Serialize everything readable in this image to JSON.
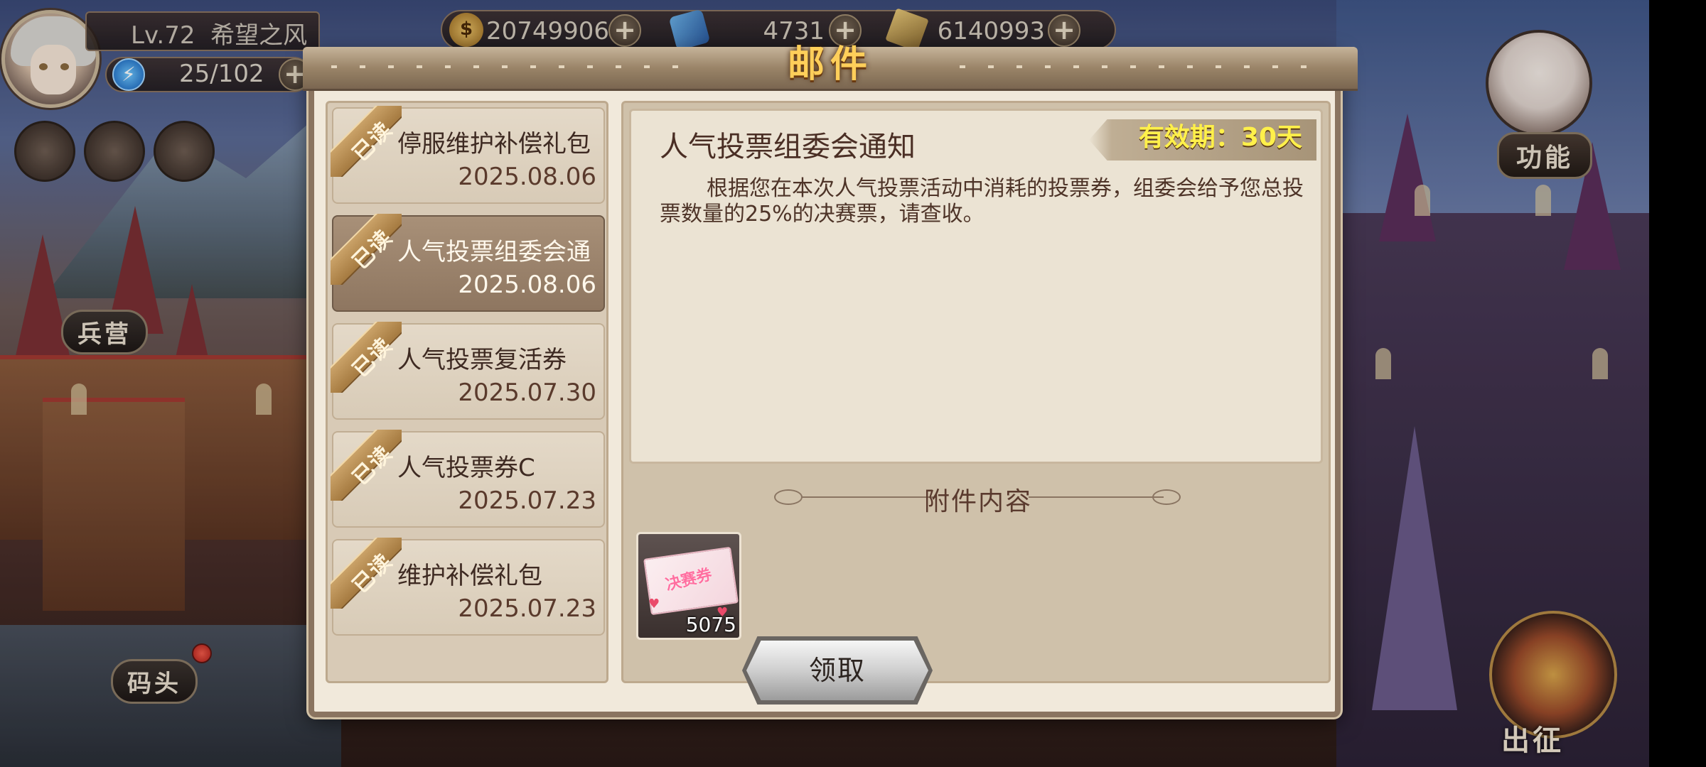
{
  "hud": {
    "level": "Lv.72",
    "player_name": "希望之风",
    "energy": "25/102",
    "gold": "20749906",
    "ticket": "4731",
    "gem": "6140993",
    "gold_icon_glyph": "$",
    "plus": "+",
    "energy_glyph": "⚡"
  },
  "side": {
    "barracks_label": "兵营",
    "dock_label": "码头",
    "function_label": "功能",
    "expedition_label": "出征"
  },
  "mail": {
    "title": "邮件",
    "read_tag": "已读",
    "items": [
      {
        "title": "停服维护补偿礼包",
        "date": "2025.08.06"
      },
      {
        "title": "人气投票组委会通",
        "date": "2025.08.06"
      },
      {
        "title": "人气投票复活券",
        "date": "2025.07.30"
      },
      {
        "title": "人气投票券C",
        "date": "2025.07.23"
      },
      {
        "title": "维护补偿礼包",
        "date": "2025.07.23"
      }
    ],
    "selected": {
      "title": "人气投票组委会通知",
      "validity": "有效期：30天",
      "body": "根据您在本次人气投票活动中消耗的投票券，组委会给予您总投票数量的25%的决赛票，请查收。"
    },
    "attachment_header": "附件内容",
    "attachment": {
      "label": "决赛券",
      "count": "5075"
    },
    "claim_button": "领取"
  },
  "colors": {
    "title_gold": "#ffcf5a",
    "validity_yellow": "#fff04a",
    "dialog_bg": "#f1e9db"
  }
}
